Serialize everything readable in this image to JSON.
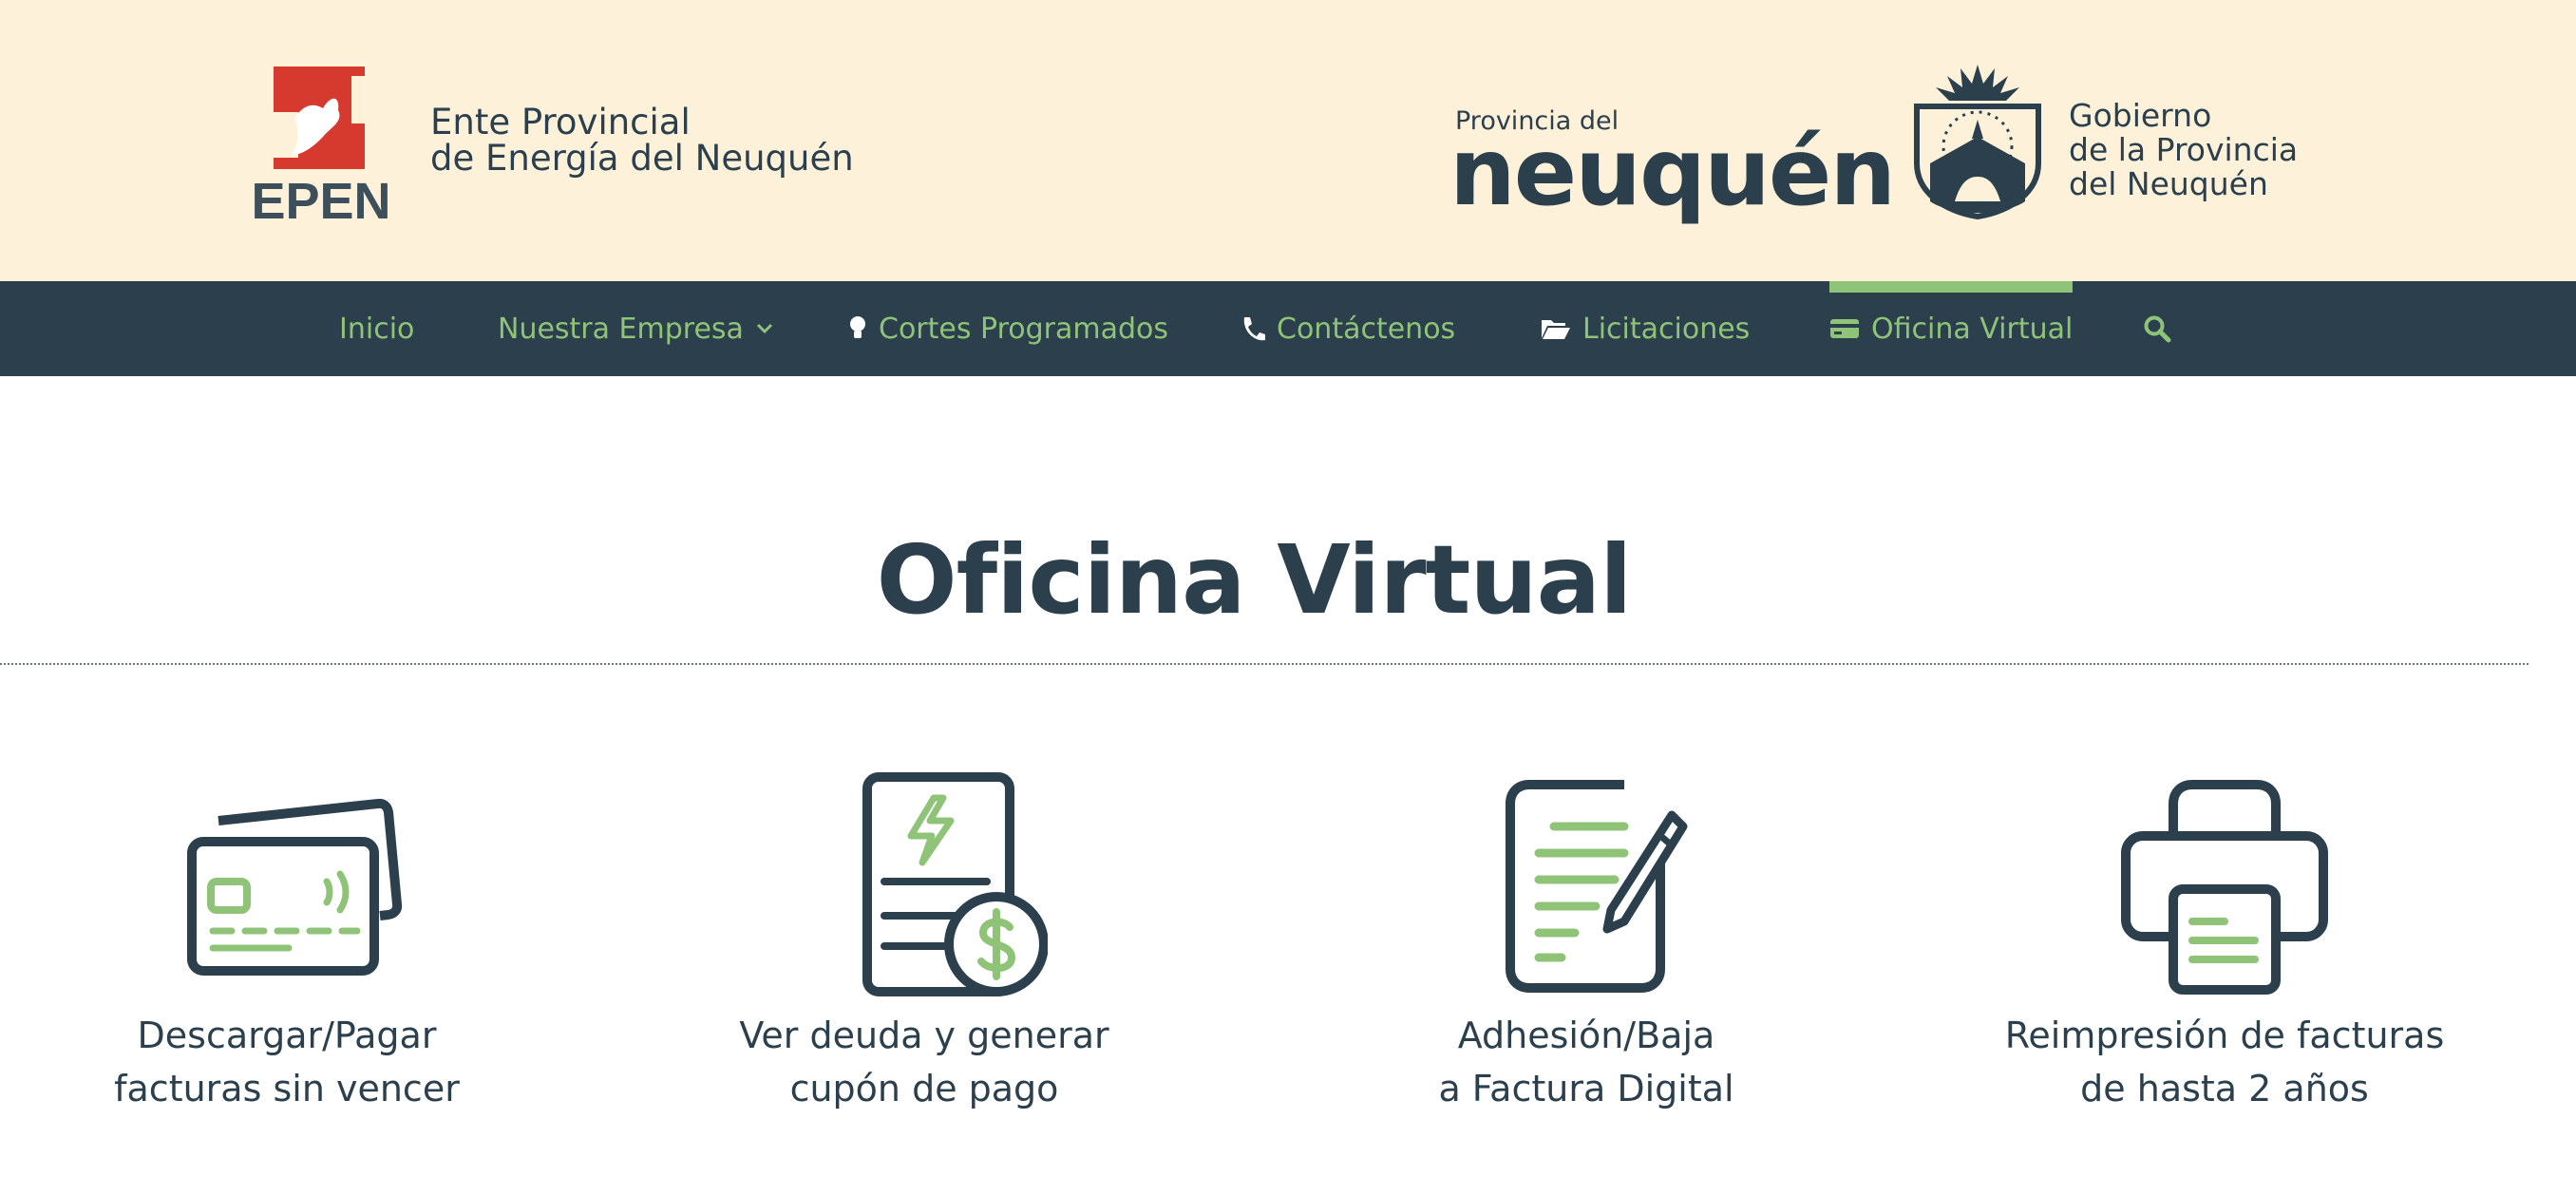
{
  "header": {
    "epen": {
      "wordmark": "EPEN",
      "line1": "Ente Provincial",
      "line2": "de Energía del Neuquén"
    },
    "neuquen_logo": {
      "small": "Provincia del",
      "big": "neuquén"
    },
    "gobierno": {
      "line1": "Gobierno",
      "line2": "de la Provincia",
      "line3": "del Neuquén"
    }
  },
  "nav": {
    "items": [
      {
        "label": "Inicio",
        "icon": "none"
      },
      {
        "label": "Nuestra Empresa",
        "icon": "chevron-down-icon"
      },
      {
        "label": "Cortes Programados",
        "icon": "lightbulb-icon"
      },
      {
        "label": "Contáctenos",
        "icon": "phone-icon"
      },
      {
        "label": "Licitaciones",
        "icon": "folder-open-icon"
      },
      {
        "label": "Oficina Virtual",
        "icon": "credit-card-icon",
        "active": true
      }
    ],
    "search_icon": "search-icon"
  },
  "main": {
    "title": "Oficina Virtual",
    "cards": [
      {
        "line1": "Descargar/Pagar",
        "line2": "facturas sin vencer",
        "icon": "credit-cards-icon"
      },
      {
        "line1": "Ver deuda y generar",
        "line2": "cupón de pago",
        "icon": "invoice-dollar-icon"
      },
      {
        "line1": "Adhesión/Baja",
        "line2": "a Factura Digital",
        "icon": "document-pen-icon"
      },
      {
        "line1": "Reimpresión de facturas",
        "line2": "de hasta 2 años",
        "icon": "printer-icon"
      }
    ]
  },
  "colors": {
    "header_bg": "#fdf2d9",
    "nav_bg": "#2b3f4d",
    "accent_green": "#8fc478",
    "text_dark": "#2b3f4d",
    "logo_red": "#d63a2f"
  }
}
